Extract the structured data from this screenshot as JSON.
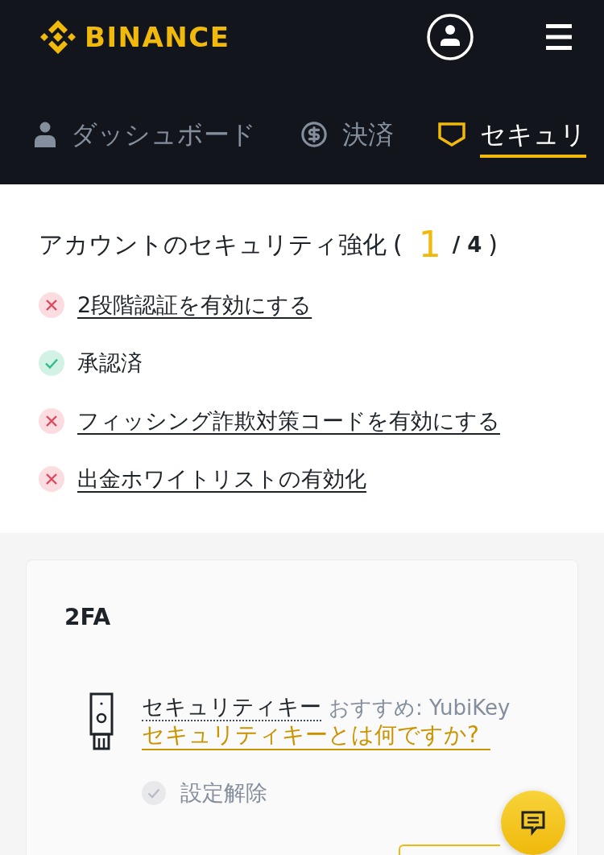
{
  "header": {
    "logo": "BINANCE"
  },
  "tabs": [
    {
      "kind": "user",
      "label": "ダッシュボード",
      "selected": false
    },
    {
      "kind": "payment",
      "label": "決済",
      "selected": false
    },
    {
      "kind": "shield",
      "label": "セキュリ",
      "selected": true
    }
  ],
  "progress": {
    "title": "アカウントのセキュリティ強化",
    "open": "(",
    "count": "1",
    "total": "/ 4",
    "close": ")",
    "items": [
      {
        "label": "2段階認証を有効にする",
        "done": false
      },
      {
        "label": "承認済",
        "done": true
      },
      {
        "label": "フィッシング詐欺対策コードを有効にする",
        "done": false
      },
      {
        "label": "出金ホワイトリストの有効化",
        "done": false
      }
    ]
  },
  "card": {
    "title": "2FA",
    "methods": [
      {
        "name": "セキュリティキー",
        "recommendation": "おすすめ: YubiKey",
        "link": "セキュリティキーとは何ですか?",
        "status": "設定解除",
        "enabled": false
      }
    ]
  }
}
